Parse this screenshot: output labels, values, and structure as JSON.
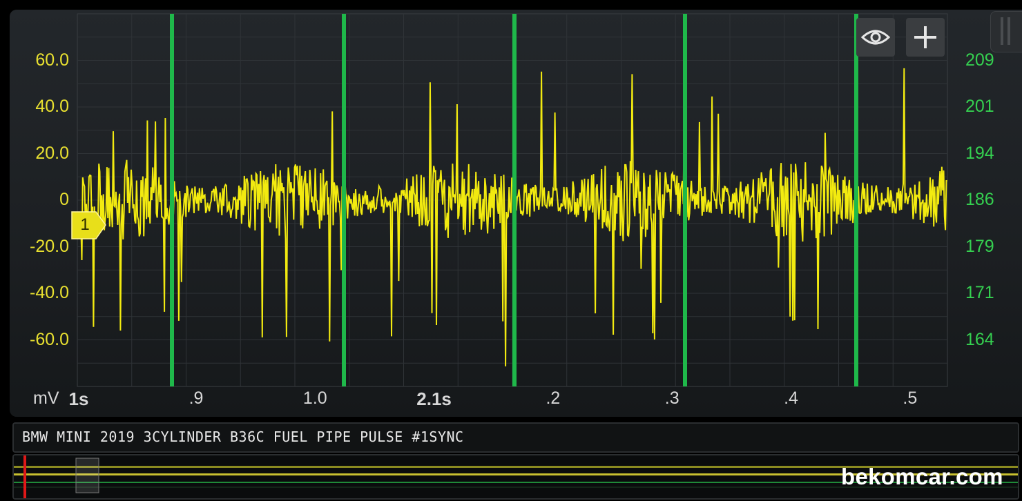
{
  "controls": {
    "eye_icon": "eye-icon",
    "add_icon": "plus-icon"
  },
  "channel_marker": "1",
  "unit_label": "mV",
  "trace_title": "BMW MINI 2019 3CYLINDER B36C FUEL PIPE PULSE #1SYNC",
  "watermark": "bekomcar.com",
  "colors": {
    "trace": "#f2ea10",
    "sync": "#1fb84a",
    "left_axis": "#e8e030",
    "right_axis": "#35d050",
    "background": "#1c1f22"
  },
  "chart_data": {
    "type": "line",
    "y_left": {
      "label": "mV",
      "ticks": [
        "60.0",
        "40.0",
        "20.0",
        "0",
        "-20.0",
        "-40.0",
        "-60.0"
      ],
      "range": [
        -80,
        80
      ]
    },
    "y_right": {
      "ticks": [
        "209",
        "201",
        "194",
        "186",
        "179",
        "171",
        "164"
      ]
    },
    "x_ticks": [
      {
        "label": "1s",
        "major": true
      },
      {
        "label": ".9",
        "major": false
      },
      {
        "label": "1.0",
        "major": false
      },
      {
        "label": "2.1s",
        "major": true
      },
      {
        "label": ".2",
        "major": false
      },
      {
        "label": ".3",
        "major": false
      },
      {
        "label": ".4",
        "major": false
      },
      {
        "label": ".5",
        "major": false
      }
    ],
    "grid": true,
    "series": [
      {
        "color": "#f2ea10",
        "baseline_mV": 0,
        "envelope_mV": [
          -20,
          20
        ],
        "peak_mV": [
          -75,
          55
        ]
      },
      {
        "color": "#1fb84a",
        "pulses_count": 5
      }
    ]
  }
}
